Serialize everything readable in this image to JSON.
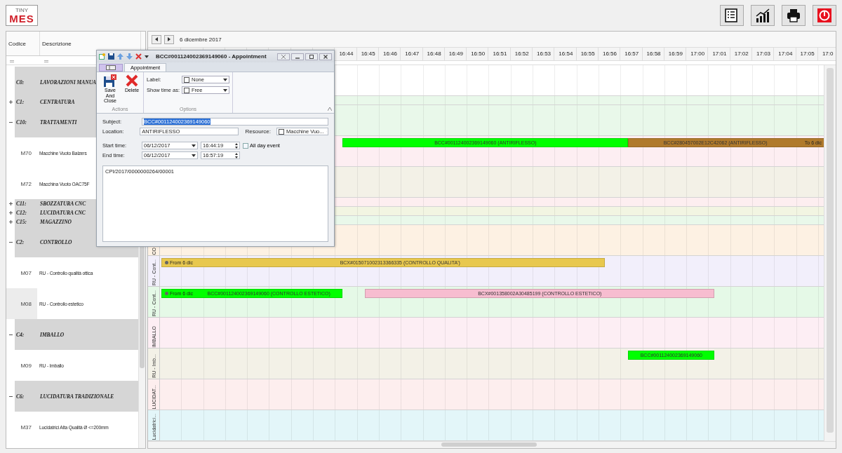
{
  "logo": {
    "small": "TINY",
    "big": "MES"
  },
  "toolbar": [
    {
      "kind": "list"
    },
    {
      "kind": "chart"
    },
    {
      "kind": "print"
    },
    {
      "kind": "power"
    }
  ],
  "grid": {
    "columns": [
      "Codice",
      "Descrizione"
    ],
    "groups": [
      {
        "code": "C0:",
        "description": "LAVORAZIONI MANUA",
        "color": "#ffffff"
      },
      {
        "code": "C1:",
        "description": "CENTRATURA",
        "expanded": false,
        "color": "#e9f8ea"
      },
      {
        "code": "C10:",
        "description": "TRATTAMENTI",
        "expanded": true,
        "color": "#e9f8ea",
        "children": [
          {
            "code": "M70",
            "description": "Macchine Vuoto Balzers",
            "selected": false,
            "color": "#fdeef2",
            "events": [
              {
                "label": "BCC#001124002369149060 (ANTIRIFLESSO)",
                "color": "#00ff00"
              },
              {
                "label": "BCC#280457002E12C42062 (ANTIRIFLESSO)",
                "to_note": "To 6 dic",
                "color": "#b07a2c"
              }
            ]
          },
          {
            "code": "M72",
            "description": "Macchina Vuoto OAC75F",
            "selected": false,
            "color": "#f3f1e7"
          }
        ]
      },
      {
        "code": "C11:",
        "description": "SBOZZATURA CNC",
        "expanded": false,
        "color": "#fdeef0"
      },
      {
        "code": "C12:",
        "description": "LUCIDATURA CNC",
        "expanded": false,
        "color": "#f2f5e2"
      },
      {
        "code": "C15:",
        "description": "MAGAZZINO",
        "expanded": false,
        "color": "#e9f8ea"
      },
      {
        "code": "C2:",
        "description": "CONTROLLO",
        "expanded": true,
        "color": "#fdf1e3",
        "resource_label": "CO",
        "children": [
          {
            "code": "M07",
            "description": "RU - Controllo qualità ottica",
            "selected": false,
            "color": "#f2effb",
            "resource_label": "RU - Cont...",
            "events": [
              {
                "label": "BCX#015071002313366335 (CONTROLLO QUALITA')",
                "from_note": "From 6 dic",
                "color": "#e8c84e"
              }
            ]
          },
          {
            "code": "M08",
            "description": "RU - Controllo estetico",
            "selected": true,
            "color": "#e5f9e7",
            "resource_label": "RU - Cont...",
            "events": [
              {
                "label": "BCC#001124002369149060 (CONTROLLO ESTETICO)",
                "from_note": "From 6 dic",
                "color": "#00ff00"
              },
              {
                "label": "BCX#001358002A30485199 (CONTROLLO ESTETICO)",
                "color": "#f7bdd0"
              }
            ]
          }
        ]
      },
      {
        "code": "C4:",
        "description": "IMBALLO",
        "expanded": true,
        "color": "#fdeef4",
        "resource_label": "IMBALLO",
        "children": [
          {
            "code": "M09",
            "description": "RU - Imballo",
            "selected": false,
            "color": "#f3f1e7",
            "resource_label": "RU - Imb...",
            "events": [
              {
                "label": "BCC#001124002369149060",
                "color": "#00ff00"
              }
            ]
          }
        ]
      },
      {
        "code": "C6:",
        "description": "LUCIDATURA TRADIZIONALE",
        "expanded": true,
        "color": "#fdeeee",
        "resource_label": "LUCIDAT...",
        "children": [
          {
            "code": "M37",
            "description": "Lucidatrici Alta Qualità Ø <=200mm",
            "selected": false,
            "color": "#e3f6f9",
            "resource_label": "Lucidatrici..."
          }
        ]
      }
    ]
  },
  "scheduler": {
    "date": "6 dicembre 2017",
    "time_labels": [
      "16:44",
      "16:45",
      "16:46",
      "16:47",
      "16:48",
      "16:49",
      "16:50",
      "16:51",
      "16:52",
      "16:53",
      "16:54",
      "16:55",
      "16:56",
      "16:57",
      "16:58",
      "16:59",
      "17:00",
      "17:01",
      "17:02",
      "17:03",
      "17:04",
      "17:05",
      "17:0"
    ]
  },
  "dialog": {
    "title": "BCC#001124002369149060 - Appointment",
    "tabs": [
      {
        "label": "Appointment",
        "selected": true
      }
    ],
    "actions": {
      "title": "Actions",
      "buttons": [
        {
          "kind": "save",
          "label": "Save And Close"
        },
        {
          "kind": "delete",
          "label": "Delete"
        }
      ]
    },
    "options": {
      "title": "Options",
      "fields": [
        {
          "label": "Label:",
          "value": "None"
        },
        {
          "label": "Show time as:",
          "value": "Free"
        }
      ]
    },
    "subject": {
      "label": "Subject:",
      "value": "BCC#001124002369149060",
      "selected": true
    },
    "location": {
      "label": "Location:",
      "value": "ANTIRIFLESSO"
    },
    "resource": {
      "label": "Resource:",
      "value": "Macchine Vuo..."
    },
    "start": {
      "label": "Start time:",
      "date": "06/12/2017",
      "time": "16:44:19"
    },
    "end": {
      "label": "End time:",
      "date": "06/12/2017",
      "time": "16:57:19"
    },
    "all_day": {
      "label": "All day event",
      "checked": false
    },
    "notes": "CPI/2017/0000000264/00001"
  }
}
